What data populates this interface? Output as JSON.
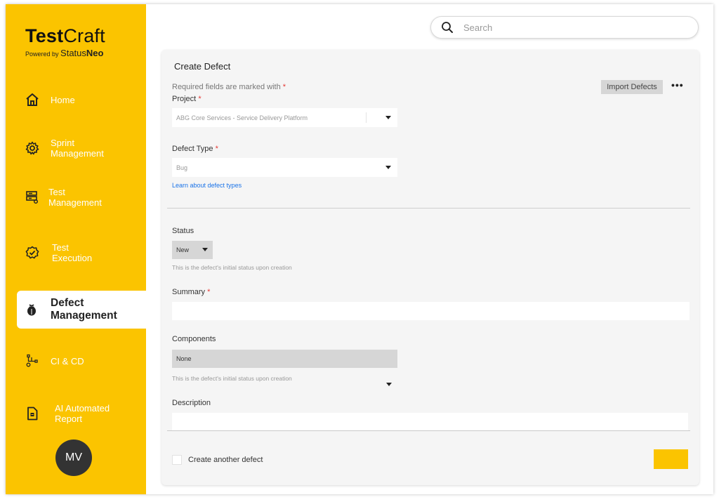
{
  "brand": {
    "name_bold": "Test",
    "name_light": "Craft",
    "powered_by": "Powered by",
    "sub_light": "Status",
    "sub_bold": "Neo"
  },
  "sidebar": {
    "items": [
      {
        "label": "Home",
        "icon": "home-icon"
      },
      {
        "label": "Sprint\nManagement",
        "icon": "gear-icon"
      },
      {
        "label": "Test\nManagement",
        "icon": "test-management-icon"
      },
      {
        "label": "Test\nExecution",
        "icon": "test-execution-icon"
      },
      {
        "label": "Defect\nManagement",
        "icon": "bug-icon"
      },
      {
        "label": "CI & CD",
        "icon": "pipeline-icon"
      },
      {
        "label": "AI Automated\nReport",
        "icon": "report-icon"
      }
    ],
    "active_index": 4
  },
  "user": {
    "initials": "MV"
  },
  "search": {
    "placeholder": "Search"
  },
  "form": {
    "title": "Create Defect",
    "required_note": "Required fields are marked with",
    "required_star": "*",
    "import_label": "Import Defects",
    "more_label": "•••",
    "project": {
      "label": "Project",
      "value": "ABG Core Services - Service Delivery Platform"
    },
    "defect_type": {
      "label": "Defect Type",
      "value": "Bug",
      "link": "Learn about defect types"
    },
    "status": {
      "label": "Status",
      "value": "New",
      "hint": "This is the defect's initial status upon creation"
    },
    "summary": {
      "label": "Summary",
      "value": ""
    },
    "components": {
      "label": "Components",
      "value": "None",
      "hint": "This is the defect's initial status upon creation"
    },
    "description": {
      "label": "Description",
      "value": ""
    },
    "create_another": {
      "label": "Create another defect",
      "checked": false
    },
    "create_button_label": ""
  },
  "colors": {
    "accent": "#FBC400",
    "sidebar_text": "#FFFFFF",
    "link": "#1A73E8",
    "required": "#E53935",
    "avatar": "#333333"
  }
}
